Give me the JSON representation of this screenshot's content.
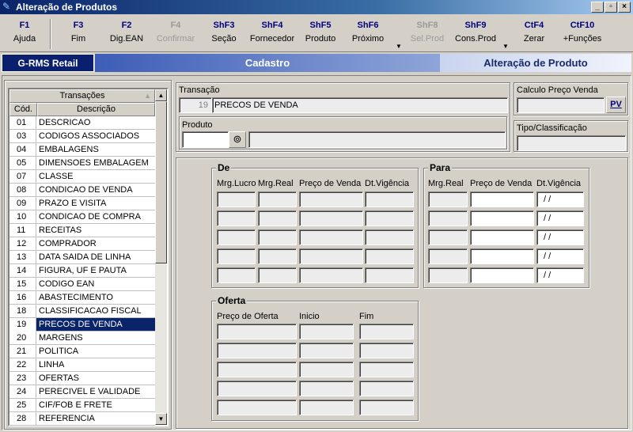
{
  "window": {
    "title": "Alteração de Produtos",
    "controls": [
      "_",
      "▫",
      "×"
    ]
  },
  "toolbar": [
    {
      "key": "F1",
      "label": "Ajuda",
      "enabled": true
    },
    {
      "key": "F3",
      "label": "Fim",
      "enabled": true
    },
    {
      "key": "F2",
      "label": "Dig.EAN",
      "enabled": true
    },
    {
      "key": "F4",
      "label": "Confirmar",
      "enabled": false
    },
    {
      "key": "ShF3",
      "label": "Seção",
      "enabled": true
    },
    {
      "key": "ShF4",
      "label": "Fornecedor",
      "enabled": true
    },
    {
      "key": "ShF5",
      "label": "Produto",
      "enabled": true
    },
    {
      "key": "ShF6",
      "label": "Próximo",
      "enabled": true
    },
    {
      "key": "ShF8",
      "label": "Sel.Prod",
      "enabled": false
    },
    {
      "key": "ShF9",
      "label": "Cons.Prod",
      "enabled": true
    },
    {
      "key": "CtF4",
      "label": "Zerar",
      "enabled": true
    },
    {
      "key": "CtF10",
      "label": "+Funções",
      "enabled": true
    }
  ],
  "banner": {
    "brand": "G-RMS Retail",
    "section": "Cadastro",
    "screen": "Alteração de Produto"
  },
  "transactions": {
    "title": "Transações",
    "col_code": "Cód.",
    "col_desc": "Descrição",
    "selected_code": "19",
    "rows": [
      {
        "code": "01",
        "desc": "DESCRICAO"
      },
      {
        "code": "03",
        "desc": "CODIGOS ASSOCIADOS"
      },
      {
        "code": "04",
        "desc": "EMBALAGENS"
      },
      {
        "code": "05",
        "desc": "DIMENSOES EMBALAGEM"
      },
      {
        "code": "07",
        "desc": "CLASSE"
      },
      {
        "code": "08",
        "desc": "CONDICAO DE VENDA"
      },
      {
        "code": "09",
        "desc": "PRAZO E VISITA"
      },
      {
        "code": "10",
        "desc": "CONDICAO DE COMPRA"
      },
      {
        "code": "11",
        "desc": "RECEITAS"
      },
      {
        "code": "12",
        "desc": "COMPRADOR"
      },
      {
        "code": "13",
        "desc": "DATA SAIDA DE LINHA"
      },
      {
        "code": "14",
        "desc": "FIGURA, UF E PAUTA"
      },
      {
        "code": "15",
        "desc": "CODIGO EAN"
      },
      {
        "code": "16",
        "desc": "ABASTECIMENTO"
      },
      {
        "code": "18",
        "desc": "CLASSIFICACAO FISCAL"
      },
      {
        "code": "19",
        "desc": "PRECOS DE VENDA"
      },
      {
        "code": "20",
        "desc": "MARGENS"
      },
      {
        "code": "21",
        "desc": "POLITICA"
      },
      {
        "code": "22",
        "desc": "LINHA"
      },
      {
        "code": "23",
        "desc": "OFERTAS"
      },
      {
        "code": "24",
        "desc": "PERECIVEL E VALIDADE"
      },
      {
        "code": "25",
        "desc": "CIF/FOB E FRETE"
      },
      {
        "code": "28",
        "desc": "REFERENCIA"
      }
    ]
  },
  "transacao": {
    "label": "Transação",
    "code": "19",
    "desc": "PRECOS DE VENDA"
  },
  "produto": {
    "label": "Produto",
    "code": "",
    "desc": ""
  },
  "calculo": {
    "label": "Calculo Preço Venda",
    "value": "",
    "button": "PV"
  },
  "tipo": {
    "label": "Tipo/Classificação",
    "value": ""
  },
  "de": {
    "title": "De",
    "headers": [
      "Mrg.Lucro",
      "Mrg.Real",
      "Preço de Venda",
      "Dt.Vigência"
    ],
    "rows": [
      [
        "",
        "",
        "",
        ""
      ],
      [
        "",
        "",
        "",
        ""
      ],
      [
        "",
        "",
        "",
        ""
      ],
      [
        "",
        "",
        "",
        ""
      ],
      [
        "",
        "",
        "",
        ""
      ]
    ]
  },
  "para": {
    "title": "Para",
    "headers": [
      "Mrg.Real",
      "Preço de Venda",
      "Dt.Vigência"
    ],
    "rows": [
      [
        "",
        "",
        " / /"
      ],
      [
        "",
        "",
        " / /"
      ],
      [
        "",
        "",
        " / /"
      ],
      [
        "",
        "",
        " / /"
      ],
      [
        "",
        "",
        " / /"
      ]
    ]
  },
  "oferta": {
    "title": "Oferta",
    "headers": [
      "Preço de Oferta",
      "Inicio",
      "Fim"
    ],
    "rows": [
      [
        "",
        "",
        ""
      ],
      [
        "",
        "",
        ""
      ],
      [
        "",
        "",
        ""
      ],
      [
        "",
        "",
        ""
      ],
      [
        "",
        "",
        ""
      ]
    ]
  }
}
